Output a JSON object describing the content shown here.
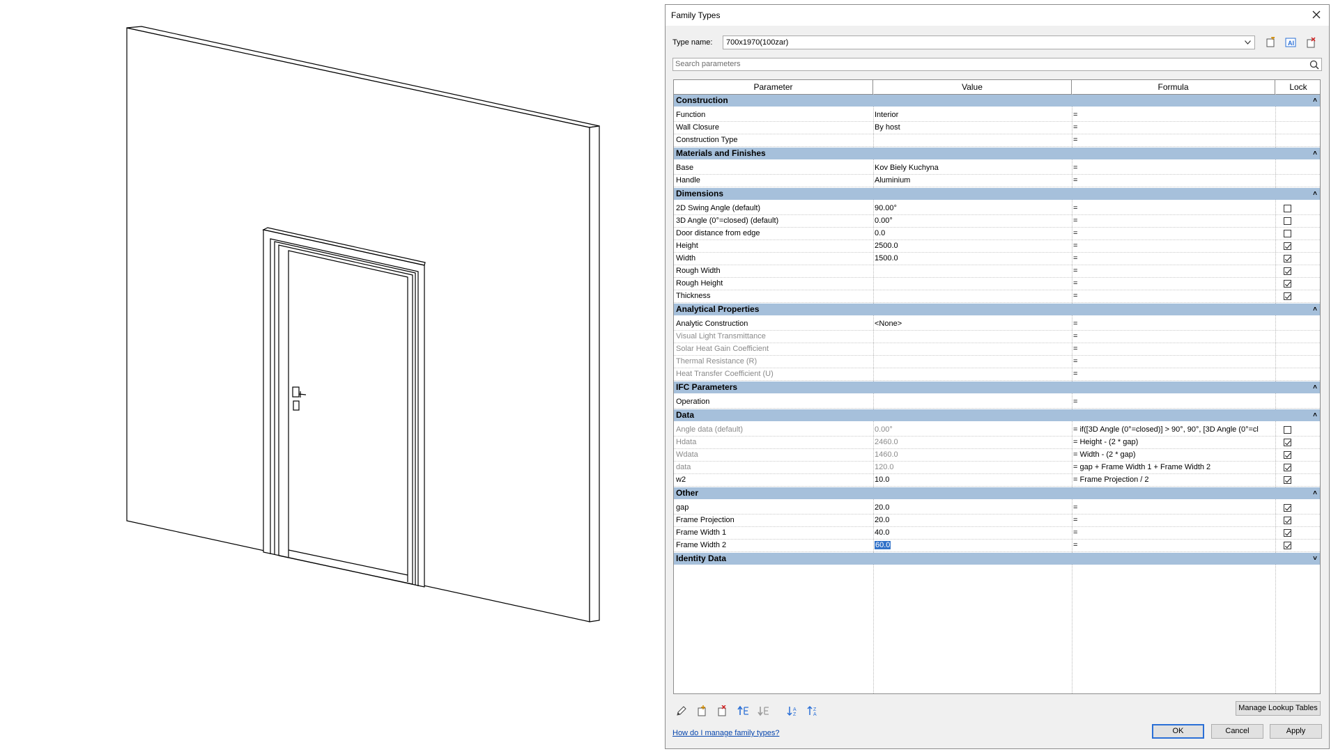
{
  "dialog": {
    "title": "Family Types",
    "type_name_label": "Type name:",
    "type_name_value": "700x1970(100zar)",
    "search_placeholder": "Search parameters",
    "columns": [
      "Parameter",
      "Value",
      "Formula",
      "Lock"
    ],
    "groups": [
      {
        "name": "Construction",
        "rows": [
          {
            "param": "Function",
            "value": "Interior",
            "formula": "="
          },
          {
            "param": "Wall Closure",
            "value": "By host",
            "formula": "="
          },
          {
            "param": "Construction Type",
            "value": "",
            "formula": "="
          }
        ]
      },
      {
        "name": "Materials and Finishes",
        "rows": [
          {
            "param": "Base",
            "value": "Kov Biely Kuchyna",
            "formula": "="
          },
          {
            "param": "Handle",
            "value": "Aluminium",
            "formula": "="
          }
        ]
      },
      {
        "name": "Dimensions",
        "rows": [
          {
            "param": "2D Swing Angle (default)",
            "value": "90.00°",
            "formula": "=",
            "lock": false
          },
          {
            "param": "3D Angle (0°=closed) (default)",
            "value": "0.00°",
            "formula": "=",
            "lock": false
          },
          {
            "param": "Door distance from edge",
            "value": "0.0",
            "formula": "=",
            "lock": false
          },
          {
            "param": "Height",
            "value": "2500.0",
            "formula": "=",
            "lock": true
          },
          {
            "param": "Width",
            "value": "1500.0",
            "formula": "=",
            "lock": true
          },
          {
            "param": "Rough Width",
            "value": "",
            "formula": "=",
            "lock": true
          },
          {
            "param": "Rough Height",
            "value": "",
            "formula": "=",
            "lock": true
          },
          {
            "param": "Thickness",
            "value": "",
            "formula": "=",
            "lock": true
          }
        ]
      },
      {
        "name": "Analytical Properties",
        "rows": [
          {
            "param": "Analytic Construction",
            "value": "<None>",
            "formula": "="
          },
          {
            "param": "Visual Light Transmittance",
            "value": "",
            "formula": "=",
            "dim": true
          },
          {
            "param": "Solar Heat Gain Coefficient",
            "value": "",
            "formula": "=",
            "dim": true
          },
          {
            "param": "Thermal Resistance (R)",
            "value": "",
            "formula": "=",
            "dim": true
          },
          {
            "param": "Heat Transfer Coefficient (U)",
            "value": "",
            "formula": "=",
            "dim": true
          }
        ]
      },
      {
        "name": "IFC Parameters",
        "rows": [
          {
            "param": "Operation",
            "value": "",
            "formula": "="
          }
        ]
      },
      {
        "name": "Data",
        "rows": [
          {
            "param": "Angle data (default)",
            "value": "0.00°",
            "formula": "= if([3D Angle (0°=closed)] > 90°, 90°, [3D Angle (0°=cl",
            "lock": false,
            "dim": true
          },
          {
            "param": "Hdata",
            "value": "2460.0",
            "formula": "= Height - (2 * gap)",
            "lock": true,
            "dim": true
          },
          {
            "param": "Wdata",
            "value": "1460.0",
            "formula": "= Width - (2 * gap)",
            "lock": true,
            "dim": true
          },
          {
            "param": "data",
            "value": "120.0",
            "formula": "= gap + Frame Width 1 + Frame Width 2",
            "lock": true,
            "dim": true
          },
          {
            "param": "w2",
            "value": "10.0",
            "formula": "= Frame Projection / 2",
            "lock": true
          }
        ]
      },
      {
        "name": "Other",
        "rows": [
          {
            "param": "gap",
            "value": "20.0",
            "formula": "=",
            "lock": true
          },
          {
            "param": "Frame Projection",
            "value": "20.0",
            "formula": "=",
            "lock": true
          },
          {
            "param": "Frame Width 1",
            "value": "40.0",
            "formula": "=",
            "lock": true
          },
          {
            "param": "Frame Width 2",
            "value": "60.0",
            "formula": "=",
            "lock": true,
            "selected": true
          }
        ]
      },
      {
        "name": "Identity Data",
        "rows": [],
        "collapsed": true
      }
    ],
    "manage_lookup_label": "Manage Lookup Tables",
    "help_link": "How do I manage family types?",
    "ok_label": "OK",
    "cancel_label": "Cancel",
    "apply_label": "Apply"
  },
  "icons": {
    "toolbar": [
      "new-type-icon",
      "rename-type-icon",
      "delete-type-icon"
    ],
    "bottom": [
      "edit-parameter-icon",
      "new-parameter-icon",
      "delete-parameter-icon",
      "move-up-icon",
      "move-down-icon",
      "sort-ascending-icon",
      "sort-descending-icon"
    ]
  },
  "colors": {
    "group_header": "#a6c0db",
    "selection": "#3272c8",
    "link": "#0645ad"
  }
}
